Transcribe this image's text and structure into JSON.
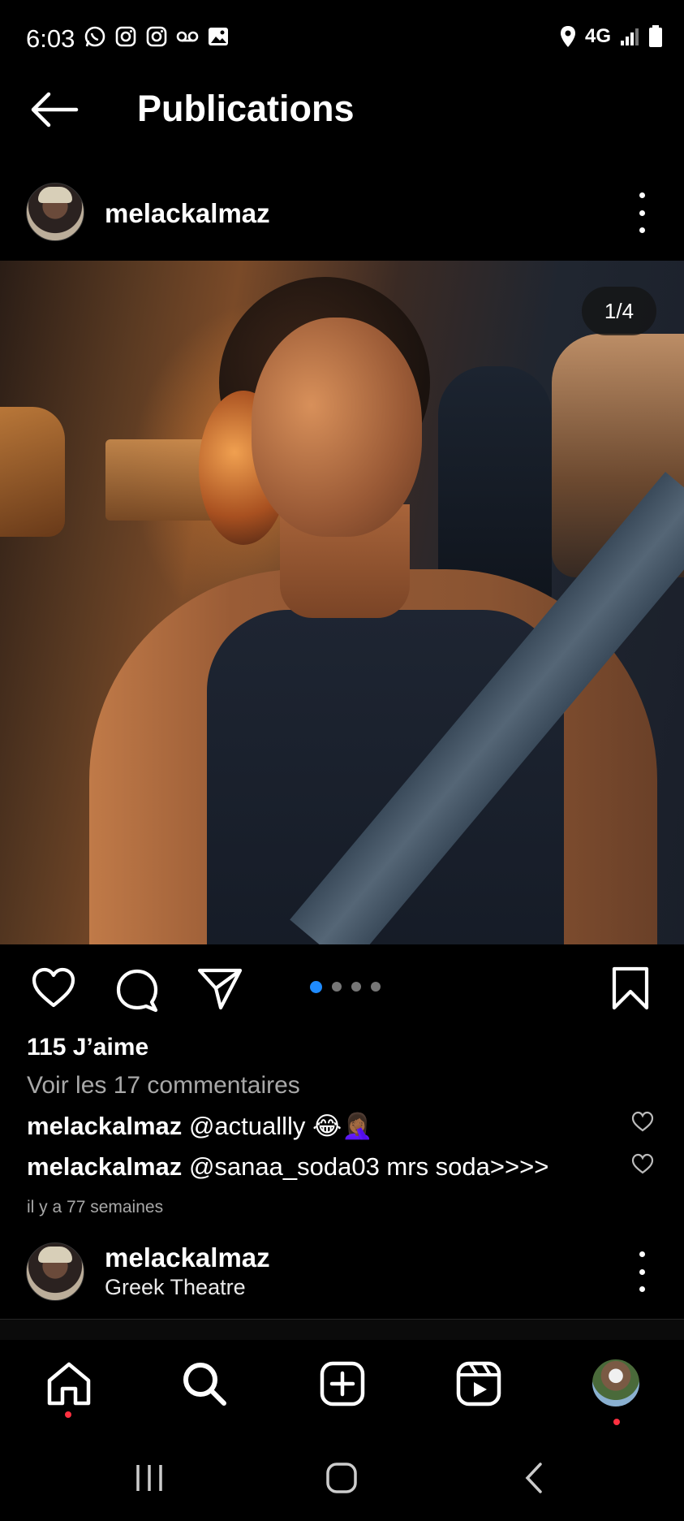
{
  "status_bar": {
    "time": "6:03",
    "network": "4G",
    "left_icons": [
      "whatsapp-icon",
      "instagram-icon",
      "instagram-icon",
      "voicemail-icon",
      "gallery-icon"
    ],
    "right_icons": [
      "location-icon",
      "network-4g-icon",
      "signal-icon",
      "battery-icon"
    ]
  },
  "header": {
    "title": "Publications"
  },
  "post": {
    "username": "melackalmaz",
    "carousel_counter": "1/4",
    "carousel": {
      "total": 4,
      "active": 1
    },
    "likes": "115 J’aime",
    "view_comments": "Voir les 17 commentaires",
    "comments": [
      {
        "user": "melackalmaz",
        "text": "@actuallly 😂🤦🏾‍♀️"
      },
      {
        "user": "melackalmaz",
        "text": "@sanaa_soda03 mrs soda>>>>"
      }
    ],
    "time_ago": "il y a 77 semaines"
  },
  "next_post": {
    "username": "melackalmaz",
    "location": "Greek Theatre"
  },
  "colors": {
    "background": "#000000",
    "carousel_active": "#1f8bff",
    "secondary_text": "#a8a8a8",
    "notification": "#ff3040"
  }
}
